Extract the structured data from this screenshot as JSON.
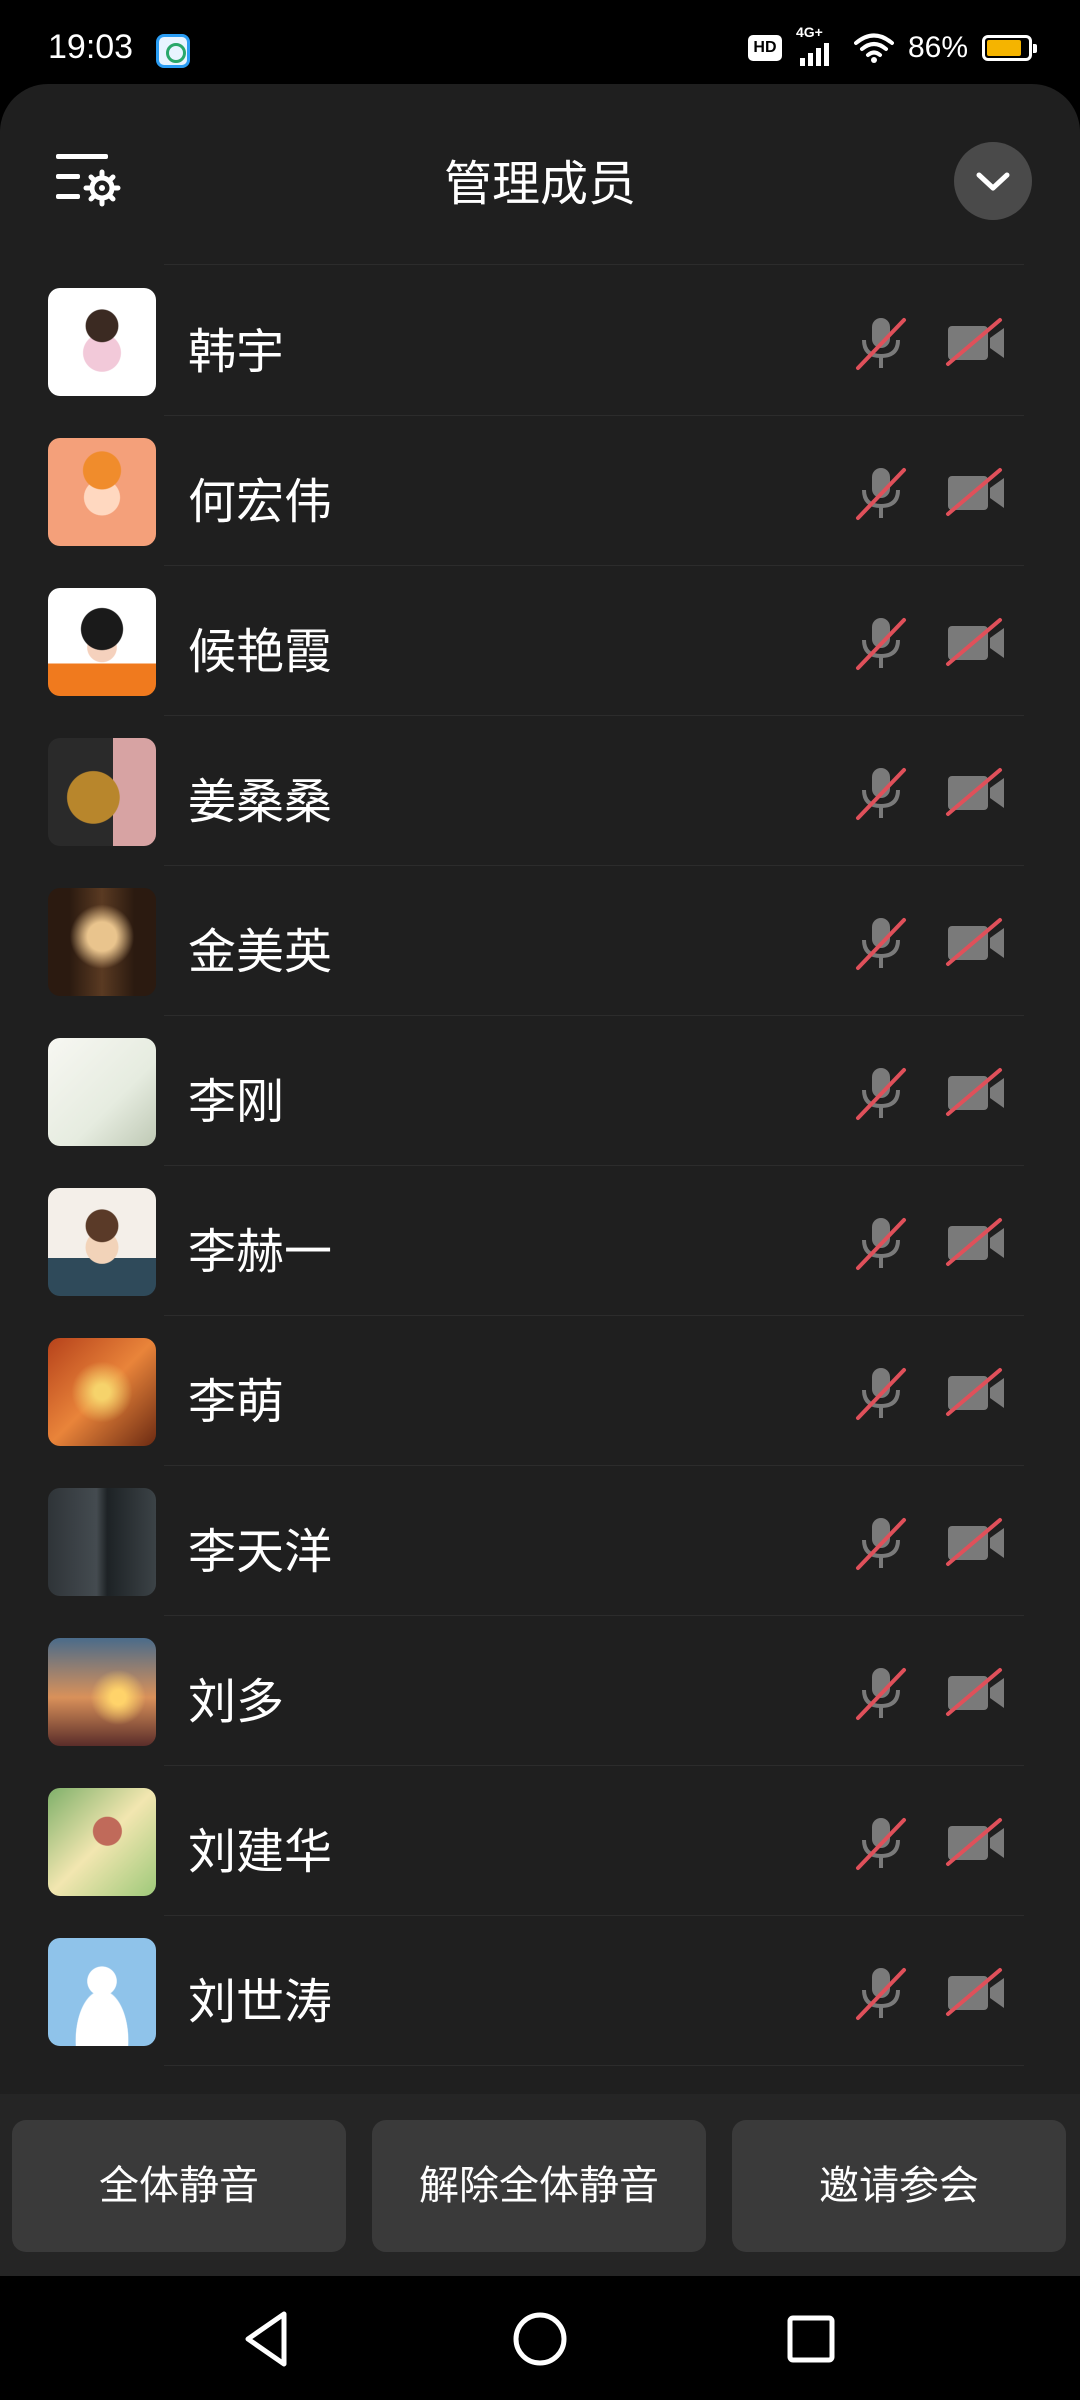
{
  "status_bar": {
    "time": "19:03",
    "network_label": "4G+",
    "hd_label": "HD",
    "battery_percent_text": "86%",
    "battery_level": 0.86,
    "battery_color": "#f5b400"
  },
  "header": {
    "title": "管理成员",
    "settings_icon": "list-settings-icon",
    "collapse_icon": "chevron-down-icon"
  },
  "members": [
    {
      "name": "韩宇",
      "mic": "muted",
      "camera": "off"
    },
    {
      "name": "何宏伟",
      "mic": "muted",
      "camera": "off"
    },
    {
      "name": "候艳霞",
      "mic": "muted",
      "camera": "off"
    },
    {
      "name": "姜桑桑",
      "mic": "muted",
      "camera": "off"
    },
    {
      "name": "金美英",
      "mic": "muted",
      "camera": "off"
    },
    {
      "name": "李刚",
      "mic": "muted",
      "camera": "off"
    },
    {
      "name": "李赫一",
      "mic": "muted",
      "camera": "off"
    },
    {
      "name": "李萌",
      "mic": "muted",
      "camera": "off"
    },
    {
      "name": "李天洋",
      "mic": "muted",
      "camera": "off"
    },
    {
      "name": "刘多",
      "mic": "muted",
      "camera": "off"
    },
    {
      "name": "刘建华",
      "mic": "muted",
      "camera": "off"
    },
    {
      "name": "刘世涛",
      "mic": "muted",
      "camera": "off"
    }
  ],
  "footer": {
    "mute_all": "全体静音",
    "unmute_all": "解除全体静音",
    "invite": "邀请参会"
  },
  "colors": {
    "muted_slash": "#e0505a",
    "icon_gray": "#7a7a7a",
    "sheet_bg": "#1f1f1f"
  }
}
